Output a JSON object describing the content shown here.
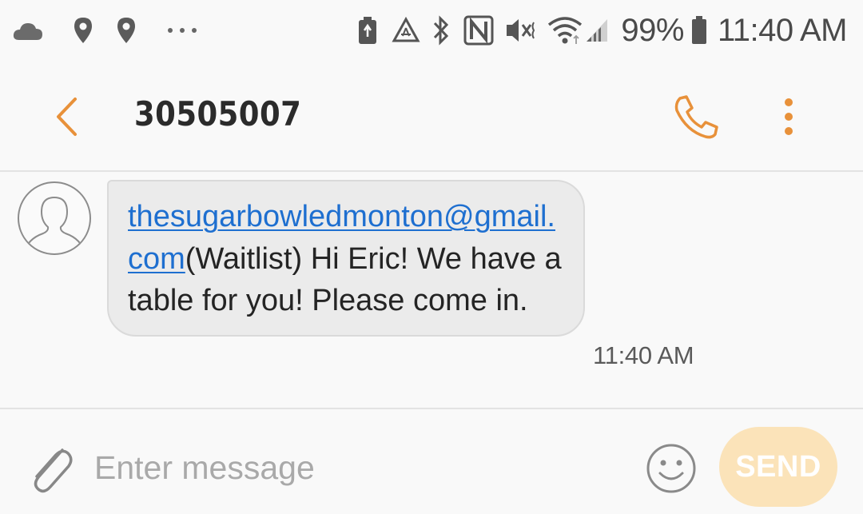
{
  "status_bar": {
    "battery_level": "99%",
    "time": "11:40 AM",
    "icons_left": [
      "cloud-icon",
      "location-pin-icon",
      "location-pin-icon",
      "more-dots-icon"
    ],
    "icons_right": [
      "battery-saver-icon",
      "recycle-icon",
      "bluetooth-icon",
      "nfc-icon",
      "vibrate-mute-icon",
      "wifi-icon",
      "signal-icon",
      "battery-icon"
    ]
  },
  "app_bar": {
    "title": "30505007",
    "icons": [
      "back-chevron-icon",
      "phone-icon",
      "more-vert-icon"
    ]
  },
  "conversation": {
    "messages": [
      {
        "link_text": "thesugarbowledmonton@gmail.com",
        "body_text": "(Waitlist) Hi Eric! We have a table for you! Please come in.",
        "time": "11:40 AM"
      }
    ]
  },
  "compose": {
    "placeholder": "Enter message",
    "send_label": "SEND",
    "icons": [
      "attach-paperclip-icon",
      "emoji-icon"
    ]
  },
  "colors": {
    "accent": "#e8913a",
    "link": "#1e6fd0",
    "bubble_bg": "#ebebeb",
    "send_disabled_bg": "#fbe3b9",
    "background": "#f9f9f9"
  }
}
